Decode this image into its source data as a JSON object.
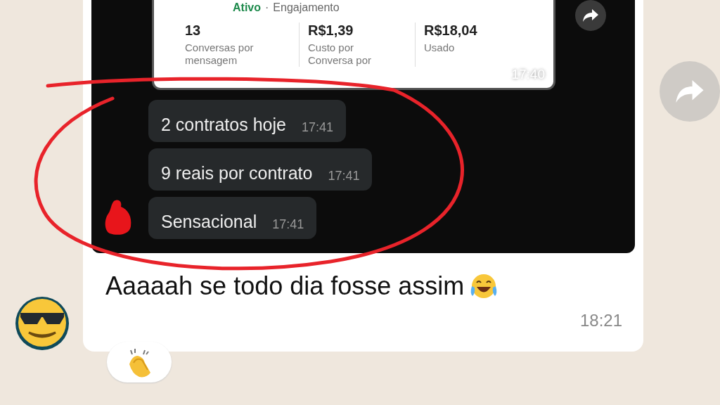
{
  "shared_screenshot": {
    "card": {
      "status": "Ativo",
      "separator": "·",
      "category": "Engajamento",
      "metrics": [
        {
          "value": "13",
          "label": "Conversas por mensagem"
        },
        {
          "value": "R$1,39",
          "label": "Custo por Conversa por"
        },
        {
          "value": "R$18,04",
          "label": "Usado"
        }
      ],
      "time": "17:40"
    },
    "messages": [
      {
        "text": "2 contratos hoje",
        "time": "17:41"
      },
      {
        "text": "9 reais por contrato",
        "time": "17:41"
      },
      {
        "text": "Sensacional",
        "time": "17:41"
      }
    ]
  },
  "caption": "Aaaaah se todo dia fosse assim",
  "time": "18:21"
}
